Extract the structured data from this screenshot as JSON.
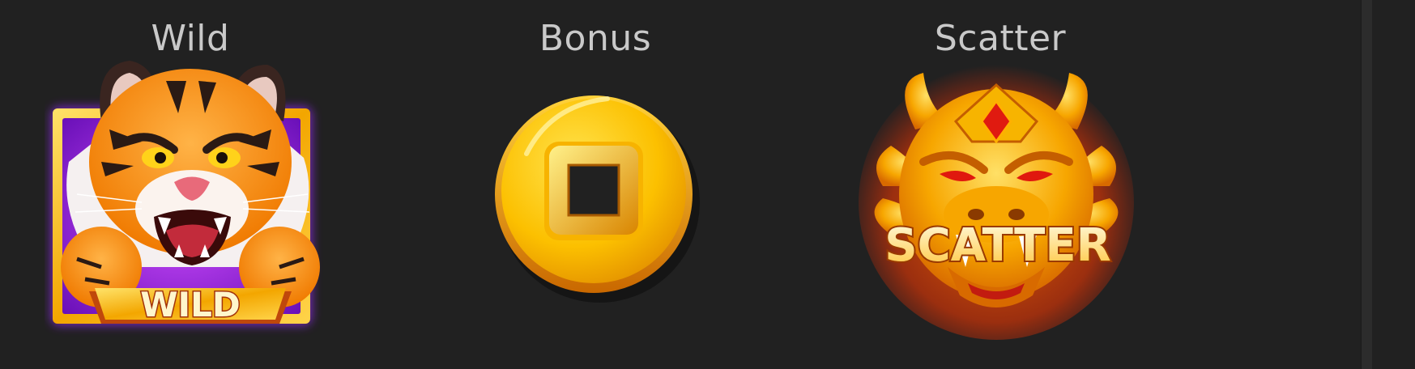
{
  "paytable": {
    "symbols": [
      {
        "label": "Wild",
        "badge_text": "WILD",
        "icon": "tiger-icon"
      },
      {
        "label": "Bonus",
        "icon": "gold-coin-icon"
      },
      {
        "label": "Scatter",
        "badge_text": "SCATTER",
        "icon": "dragon-icon"
      }
    ]
  },
  "colors": {
    "background": "#212121",
    "label_text": "#c9c9c9",
    "gold": "#f5b700",
    "wild_glow": "#9b2cff",
    "scatter_glow": "#ff4a00"
  }
}
